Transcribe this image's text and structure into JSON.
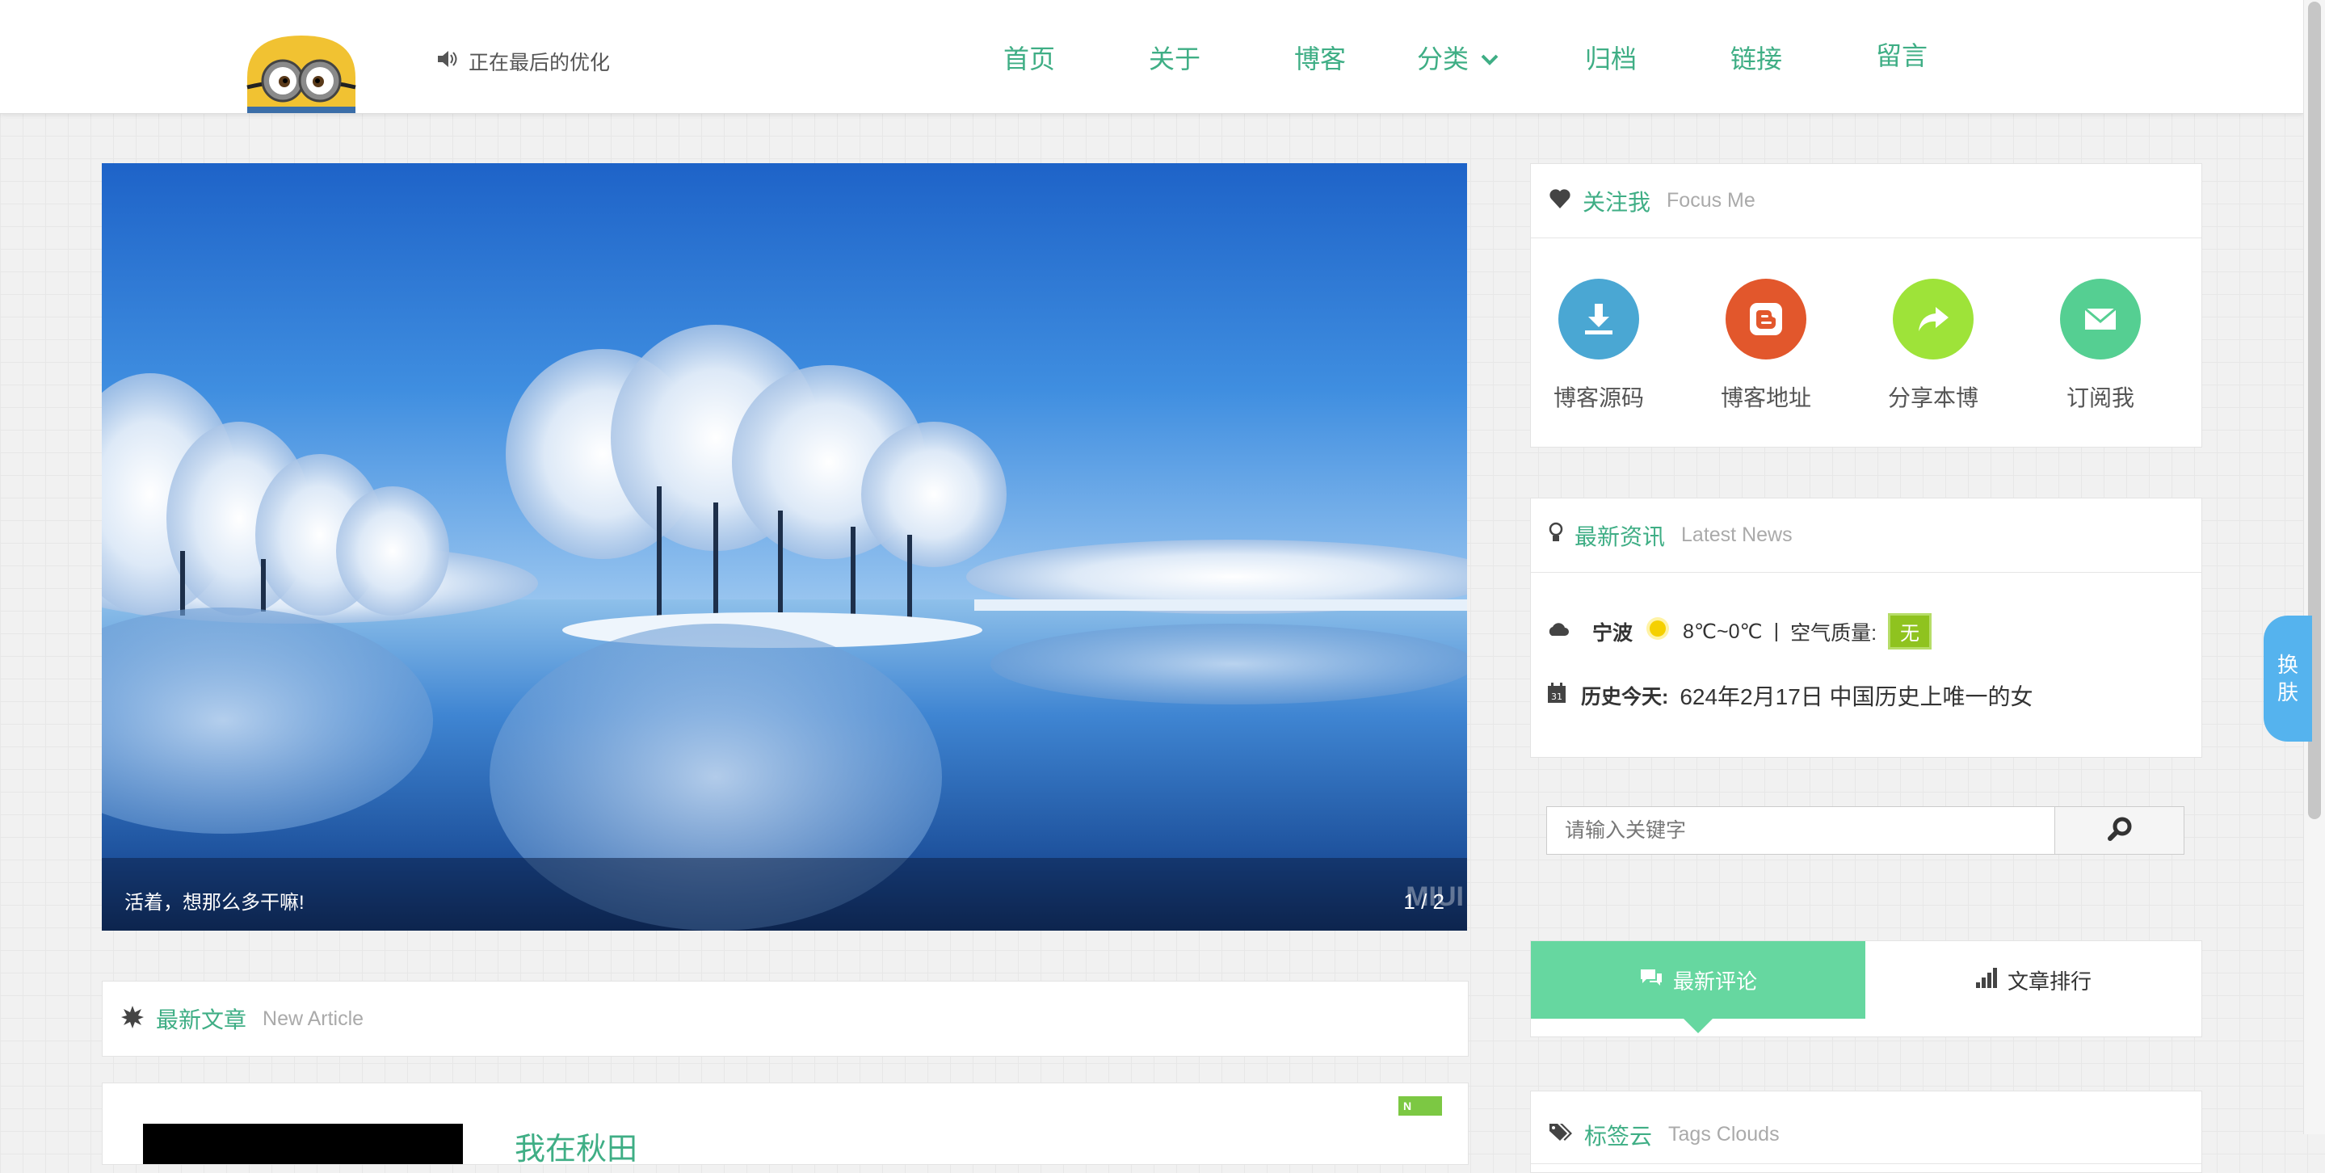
{
  "header": {
    "notice_text": "正在最后的优化",
    "nav": [
      {
        "label": "首页"
      },
      {
        "label": "关于"
      },
      {
        "label": "博客"
      },
      {
        "label": "分类"
      },
      {
        "label": "归档"
      },
      {
        "label": "链接"
      },
      {
        "label": "留言"
      }
    ]
  },
  "banner": {
    "caption": "活着，想那么多干嘛!",
    "counter": "1 / 2",
    "watermark": "MIUI"
  },
  "latest_articles": {
    "title": "最新文章",
    "subtitle": "New Article",
    "first_article_title": "我在秋田",
    "badge": "N"
  },
  "focus": {
    "title": "关注我",
    "subtitle": "Focus Me",
    "items": [
      {
        "label": "博客源码",
        "icon": "download-icon",
        "color": "#4aa7d3"
      },
      {
        "label": "博客地址",
        "icon": "blogger-icon",
        "color": "#e2572c"
      },
      {
        "label": "分享本博",
        "icon": "share-icon",
        "color": "#9ee339"
      },
      {
        "label": "订阅我",
        "icon": "mail-icon",
        "color": "#55cf92"
      }
    ]
  },
  "news": {
    "title": "最新资讯",
    "subtitle": "Latest News",
    "city": "宁波",
    "temperature": "8℃~0℃",
    "separator": "|",
    "air_label": "空气质量:",
    "air_value": "无",
    "history_label": "历史今天:",
    "history_text": "624年2月17日 中国历史上唯一的女"
  },
  "search": {
    "placeholder": "请输入关键字"
  },
  "tabs": [
    {
      "label": "最新评论",
      "icon": "comments-icon"
    },
    {
      "label": "文章排行",
      "icon": "signal-icon"
    }
  ],
  "tags": {
    "title": "标签云",
    "subtitle": "Tags Clouds"
  },
  "skin_button": {
    "chars": [
      "换",
      "肤"
    ]
  },
  "colors": {
    "accent": "#3fae85",
    "tab_active": "#66d7a0",
    "skin_button": "#55b3ee"
  }
}
